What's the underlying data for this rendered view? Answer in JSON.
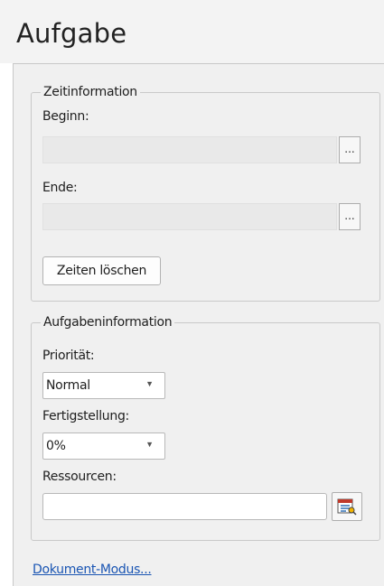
{
  "page": {
    "title": "Aufgabe"
  },
  "time_info": {
    "legend": "Zeitinformation",
    "begin_label": "Beginn:",
    "begin_value": "",
    "end_label": "Ende:",
    "end_value": "",
    "picker_label": "...",
    "clear_button": "Zeiten löschen"
  },
  "task_info": {
    "legend": "Aufgabeninformation",
    "priority_label": "Priorität:",
    "priority_value": "Normal",
    "completion_label": "Fertigstellung:",
    "completion_value": "0%",
    "resources_label": "Ressourcen:",
    "resources_value": ""
  },
  "footer": {
    "document_mode_link": "Dokument-Modus..."
  },
  "colors": {
    "link": "#1a55b3",
    "pane_background": "#f0f0f0"
  },
  "icons": {
    "resources_button": "address-book-icon",
    "dropdown": "chevron-down-icon"
  }
}
